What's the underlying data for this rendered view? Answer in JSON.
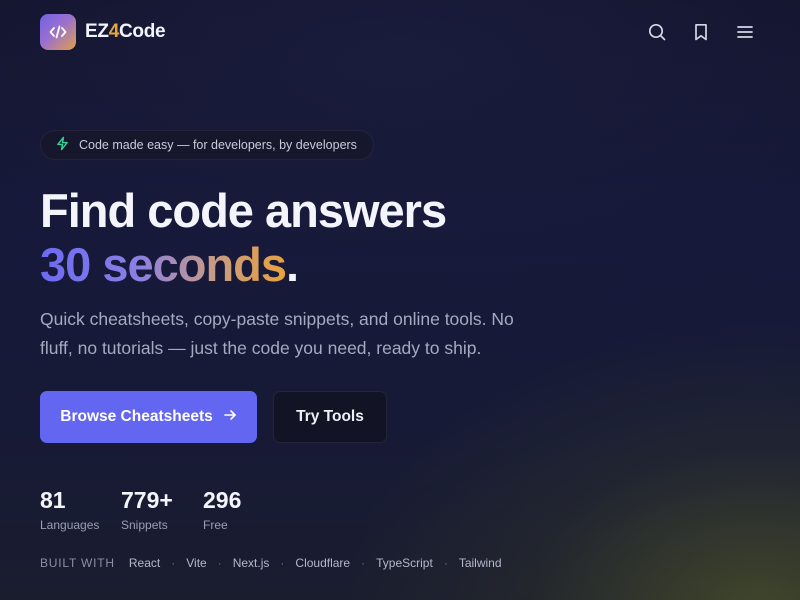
{
  "header": {
    "brand_prefix": "EZ",
    "brand_accent": "4",
    "brand_suffix": "Code",
    "icons": [
      "search-icon",
      "bookmark-icon",
      "menu-icon"
    ]
  },
  "hero": {
    "badge_text": "Code made easy — for developers, by developers",
    "headline_line1": "Find code answers",
    "headline_highlight": "30 seconds",
    "headline_end": ".",
    "subtitle": "Quick cheatsheets, copy-paste snippets, and online tools. No fluff, no tutorials — just the code you need, ready to ship.",
    "primary_button": "Browse Cheatsheets",
    "secondary_button": "Try Tools"
  },
  "stats": [
    {
      "value": "81",
      "label": "Languages"
    },
    {
      "value": "779+",
      "label": "Snippets"
    },
    {
      "value": "296",
      "label": "Free"
    }
  ],
  "built_with": {
    "label": "BUILT WITH",
    "items": [
      "React",
      "Vite",
      "Next.js",
      "Cloudflare",
      "TypeScript",
      "Tailwind"
    ]
  },
  "colors": {
    "accent": "#6366f1",
    "brand_orange": "#e6a43f",
    "badge_icon": "#34d399"
  }
}
